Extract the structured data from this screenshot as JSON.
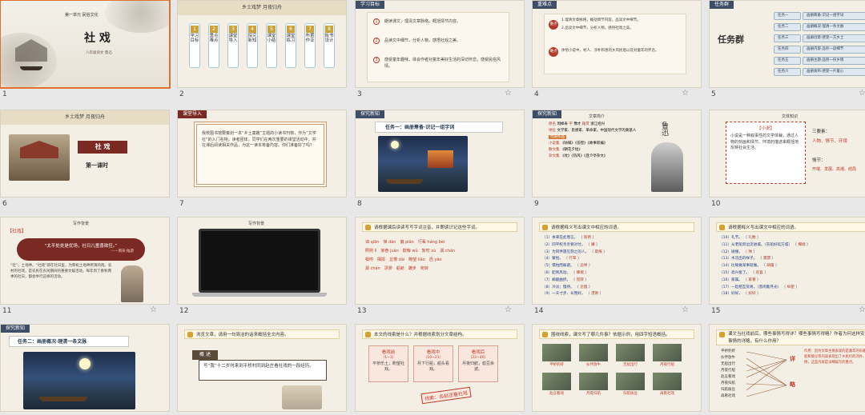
{
  "slides": [
    {
      "num": "1",
      "unit": "第一单元  民俗文化",
      "title": "社 戏",
      "subtitle": "八年级语文  鲁迅"
    },
    {
      "num": "2",
      "header": "乡土戏梦  月夜归舟",
      "items": [
        {
          "n": "1",
          "t": "学习目标"
        },
        {
          "n": "2",
          "t": "重点难点"
        },
        {
          "n": "3",
          "t": "课堂导入"
        },
        {
          "n": "4",
          "t": "探究新知"
        },
        {
          "n": "5",
          "t": "课堂小结"
        },
        {
          "n": "6",
          "t": "课堂练习"
        },
        {
          "n": "7",
          "t": "布置作业"
        },
        {
          "n": "8",
          "t": "板书设计"
        }
      ]
    },
    {
      "num": "3",
      "tag": "学习目标",
      "goals": [
        "朗读课文，理清文章脉络，概括情节内容。",
        "品读文中细节，分析人物，感悟社戏之美。",
        "感受童年趣味，体会作者对童年美好生活的深切怀恋，感受民俗风情。"
      ]
    },
    {
      "num": "4",
      "tag": "重难点",
      "key_label": "重点",
      "key_lines": [
        "1.理清文章脉络，概括情节内容，品读文中细节。",
        "2.品读文中细节，分析人物，感悟社戏之美。"
      ],
      "diff_label": "难点",
      "diff_line": "体悟小说中，村人、淳朴和善的乡风民俗以及对童年的怀念。"
    },
    {
      "num": "5",
      "tag": "任务群",
      "title": "任务群",
      "tasks": [
        {
          "k": "任务一",
          "v": "画册筹备·识记一组字词"
        },
        {
          "k": "任务二",
          "v": "画册概况·理清一条文脉"
        },
        {
          "k": "任务三",
          "v": "画册创意·感受一方乡土"
        },
        {
          "k": "任务四",
          "v": "画册内容·品析一段细节"
        },
        {
          "k": "任务五",
          "v": "画册主题·品悟一份乡情"
        },
        {
          "k": "任务六",
          "v": "画册发布·感受一片童心"
        }
      ]
    },
    {
      "num": "6",
      "header": "乡土戏梦  月夜归舟",
      "title": "社 戏",
      "period": "第一课时"
    },
    {
      "num": "7",
      "tag": "课堂导入",
      "text": "我校图书馆要策划一本“乡土童趣”主题的小读书刊物，作为“文学社”的入门名物，读者团体，同学们在两次重要的课堂活动中，并在课后阅读相关作品，为这一读本筹备内容。你们准备好了吗？"
    },
    {
      "num": "8",
      "tag": "探究新知",
      "task": "任务一：画册筹备·识记一组字词"
    },
    {
      "num": "9",
      "tag": "探究新知",
      "sec": "文章简介",
      "rows": [
        {
          "k": "原名",
          "v": "周樟寿"
        },
        {
          "k": "字",
          "v": "豫才"
        },
        {
          "k": "籍贯",
          "v": "浙江绍兴"
        },
        {
          "k": "地位",
          "v": "文学家、思想家、革命家，中国现代文学的奠基人"
        }
      ],
      "works_label": "代表作品",
      "works": [
        {
          "k": "小说集",
          "v": "《呐喊》《彷徨》《故事新编》"
        },
        {
          "k": "散文集",
          "v": "《朝花夕拾》"
        },
        {
          "k": "杂文集",
          "v": "《坟》《热风》《且介亭杂文》"
        }
      ],
      "portrait": "鲁迅"
    },
    {
      "num": "10",
      "sec": "文体知识",
      "box_title": "【小说】",
      "box_text": "小说是一种叙事性的文学体裁，通过人物的刻画和情节、环境的描述来概括地反映社会生活。",
      "three_label": "三要素：",
      "three": [
        "人物、情节、环境"
      ],
      "plot_label": "情节：",
      "plot": "开端、发展、高潮、结局"
    },
    {
      "num": "11",
      "sec": "写作背景",
      "tag_text": "【社戏】",
      "quote": "“太平处处是优场，社日儿童喜欲狂。”",
      "quote_by": "——南宋·陆游",
      "body": "“社”，土地神。“社戏”即在社日里，为祭祀土地神所演的戏。农村的社戏，是农民在农闲期间的重要文娱活动，每年到了春秋两季的社日，都会举行这样的活动。"
    },
    {
      "num": "12",
      "sec": "写作背景"
    },
    {
      "num": "13",
      "hdr": "请根据课后读读写写字词注音，并朗读识记这些字词。",
      "words": [
        [
          "诎 qiān",
          "惮 dàn",
          "偏 piān",
          "行辈 háng bèi"
        ],
        [
          "照例 lì",
          "家眷 juàn",
          "欺侮 wǔ",
          "絮叨 xù",
          "潺 chán"
        ],
        [
          "嘱咐",
          "撺掇",
          "怠慢 dài",
          "瞭望 liǎo",
          "舀 yǎo"
        ],
        [
          "潺 chán",
          "漂渺",
          "船舱",
          "踱步",
          "宛转"
        ]
      ]
    },
    {
      "num": "14",
      "hdr": "请根据释义写出课文中相应的词语。",
      "items": [
        {
          "q": "（1）本来在此而言。",
          "a": "照例"
        },
        {
          "q": "（2）同平权亲亲要对付。",
          "a": "嫌"
        },
        {
          "q": "（3）为同伴遇见怒之的人。",
          "a": "欺侮"
        },
        {
          "q": "（4）蒙拾。",
          "a": "行辈"
        },
        {
          "q": "（5）惧怕而躲避。",
          "a": "忌惮"
        },
        {
          "q": "（6）起到风动。",
          "a": "撺掇"
        },
        {
          "q": "（7）蜿蜒曲折。",
          "a": "宛转"
        },
        {
          "q": "（8）冷淡；慢待。",
          "a": "怠慢"
        },
        {
          "q": "（9）一天寸步、长而好。",
          "a": "漂渺"
        }
      ]
    },
    {
      "num": "15",
      "hdr": "请根据释义写出课文中相应的词语。",
      "items": [
        {
          "q": "（10）礼节。",
          "a": "礼数"
        },
        {
          "q": "（11）从老船旁边流进城。（东船好延方城）",
          "a": "撺掇"
        },
        {
          "q": "（12）碰撞。",
          "a": "惮"
        },
        {
          "q": "（13）水流出的样子。",
          "a": "潺潺"
        },
        {
          "q": "（14）比喻做某事就做。",
          "a": "踌躇"
        },
        {
          "q": "（15）高兴极了。",
          "a": "欢喜"
        },
        {
          "q": "（16）家属。",
          "a": "家眷"
        },
        {
          "q": "（17）一起相互贸易。（悠闲着月光）",
          "a": "纵使"
        },
        {
          "q": "（18）好好。",
          "a": "好好"
        }
      ]
    },
    {
      "num": "16",
      "tag": "探究新知",
      "task": "任务二：画册概况·理清一条文脉"
    },
    {
      "num": "17",
      "hdr": "浏览文章，请用一句简洁的话来概括全文内容。",
      "label": "概 述",
      "summary": "写“我”十二岁时来到平桥村同到赵庄看社戏的一段经历。"
    },
    {
      "num": "18",
      "hdr": "本文的线索是什么？并根据线索划分文章结构。",
      "parts": [
        {
          "t": "看戏前",
          "r": "（1~3）",
          "d": "平桥乐土，盼望社戏。"
        },
        {
          "t": "看戏中",
          "r": "（10~21）",
          "d": "月下行船，船头看戏。"
        },
        {
          "t": "看戏后",
          "r": "（22~40）",
          "d": "月夜归航，偷豆余波。"
        }
      ],
      "stamp": "线索：去赵庄看社戏"
    },
    {
      "num": "19",
      "hdr": "围绕线索，课文写了哪几件事？依据示例，用四字短语概括。",
      "events": [
        "平桥钓虾",
        "伙伴放牛",
        "无船出行",
        "月夜行船",
        "赵庄看戏",
        "月夜归航",
        "归航偷豆",
        "再看社戏"
      ]
    },
    {
      "num": "20",
      "hdr": "课文当社戏前后，哪些事情写得详？哪些事情写得略？作者为何这样安排事情的详略，有什么作用？",
      "list": [
        "平桥钓虾",
        "伙伴放牛",
        "无船出行",
        "月夜行船",
        "赵庄看戏",
        "月夜归航",
        "归航偷豆",
        "再看社戏"
      ],
      "detail": "详",
      "brief": "略",
      "note": "作用：因为文章主要表现的是童年的乐趣，行船和偷豆等内容表现出了乡民们的淳朴、热情，这些内容是详细描写的重点。"
    }
  ]
}
